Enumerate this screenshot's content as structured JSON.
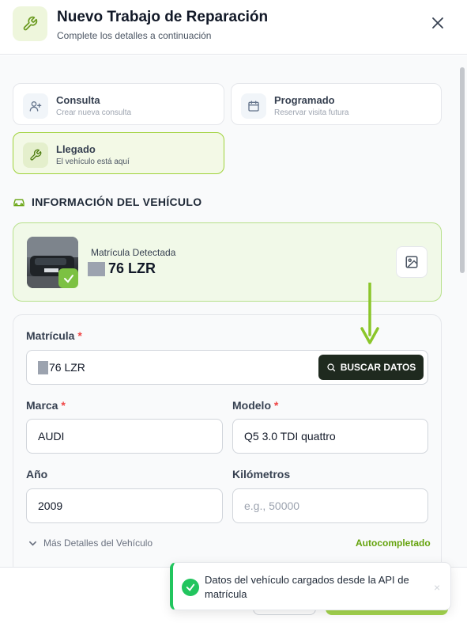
{
  "header": {
    "title": "Nuevo Trabajo de Reparación",
    "subtitle": "Complete los detalles a continuación",
    "icon": "wrench-icon",
    "close_icon": "close-icon"
  },
  "options": [
    {
      "title": "Consulta",
      "subtitle": "Crear nueva consulta",
      "icon": "user-plus-icon",
      "active": false
    },
    {
      "title": "Programado",
      "subtitle": "Reservar visita futura",
      "icon": "calendar-icon",
      "active": false
    },
    {
      "title": "Llegado",
      "subtitle": "El vehículo está aquí",
      "icon": "wrench-icon",
      "active": true
    }
  ],
  "vehicle_section": {
    "title": "INFORMACIÓN DEL VEHÍCULO",
    "icon": "car-icon"
  },
  "plate_detection": {
    "label": "Matrícula Detectada",
    "value": "76 LZR",
    "thumbnail_icon": "car-photo-thumbnail",
    "status_icon": "check-icon",
    "upload_icon": "image-icon"
  },
  "form": {
    "plate_label": "Matrícula",
    "plate_value": "76 LZR",
    "search_button": "BUSCAR DATOS",
    "brand_label": "Marca",
    "brand_value": "AUDI",
    "model_label": "Modelo",
    "model_value": "Q5 3.0 TDI quattro",
    "year_label": "Año",
    "year_value": "2009",
    "km_label": "Kilómetros",
    "km_placeholder": "e.g., 50000",
    "required_mark": "*",
    "more_details": "Más Detalles del Vehículo",
    "autocompleted": "Autocompletado"
  },
  "toast": {
    "message": "Datos del vehículo cargados desde la API de matrícula",
    "close": "×"
  },
  "colors": {
    "accent": "#9fd23a",
    "success": "#22c55e",
    "dark_button": "#1f2a1f",
    "required": "#ef4444",
    "arrow": "#8bc62a"
  }
}
